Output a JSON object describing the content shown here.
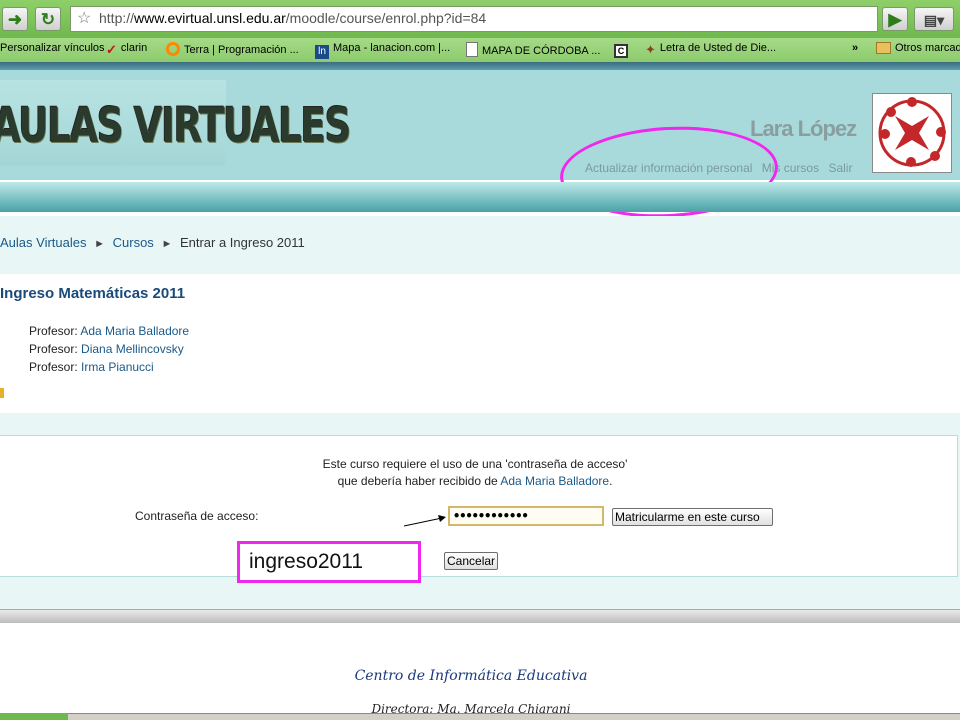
{
  "browser": {
    "url_prefix": "http://",
    "url_host": "www.evirtual.unsl.edu.ar",
    "url_path": "/moodle/course/enrol.php?id=84",
    "more_glyph": "»",
    "bookmarks": [
      {
        "label": "Personalizar vínculos",
        "icon_color": "#ffffff"
      },
      {
        "label": "clarin",
        "icon_color": "#cc1111"
      },
      {
        "label": "Terra | Programación ...",
        "icon_color": "#ff8800"
      },
      {
        "label": "Mapa - lanacion.com |...",
        "icon_color": "#1a4a8a"
      },
      {
        "label": "MAPA DE CÓRDOBA ...",
        "icon_color": "#ffffff"
      },
      {
        "label": "Letra de Usted de Die...",
        "icon_color": "#884422"
      },
      {
        "label": "Otros marcad",
        "icon_color": "#e8c060"
      }
    ],
    "icons": {
      "back": "arrow-right",
      "reload": "refresh",
      "bookmark": "star",
      "go": "play",
      "page": "page-menu"
    }
  },
  "header": {
    "site_logo": "AULAS VIRTUALES",
    "user_name": "Lara López",
    "links": [
      "Actualizar información personal",
      "Mis cursos",
      "Salir"
    ],
    "annotation_color": "#ee28ee"
  },
  "breadcrumb": {
    "items": [
      "Aulas Virtuales",
      "Cursos",
      "Entrar a Ingreso 2011"
    ],
    "separator": "►"
  },
  "course": {
    "title": "Ingreso Matemáticas 2011",
    "teacher_role": "Profesor:",
    "teachers": [
      "Ada Maria Balladore",
      "Diana Mellincovsky",
      "Irma Pianucci"
    ]
  },
  "enrol": {
    "message_line1": "Este curso requiere el uso de una 'contraseña de acceso'",
    "message_line2_prefix": "que debería haber recibido de",
    "message_line2_link": "Ada Maria Balladore",
    "message_line2_suffix": ".",
    "password_label": "Contraseña de acceso:",
    "password_value": "••••••••••••",
    "enrol_button": "Matricularme en este curso",
    "cancel_button": "Cancelar",
    "hint_text": "ingreso2011"
  },
  "footer": {
    "title": "Centro de Informática Educativa",
    "line2": "Directora: Ma. Marcela Chiarani"
  }
}
